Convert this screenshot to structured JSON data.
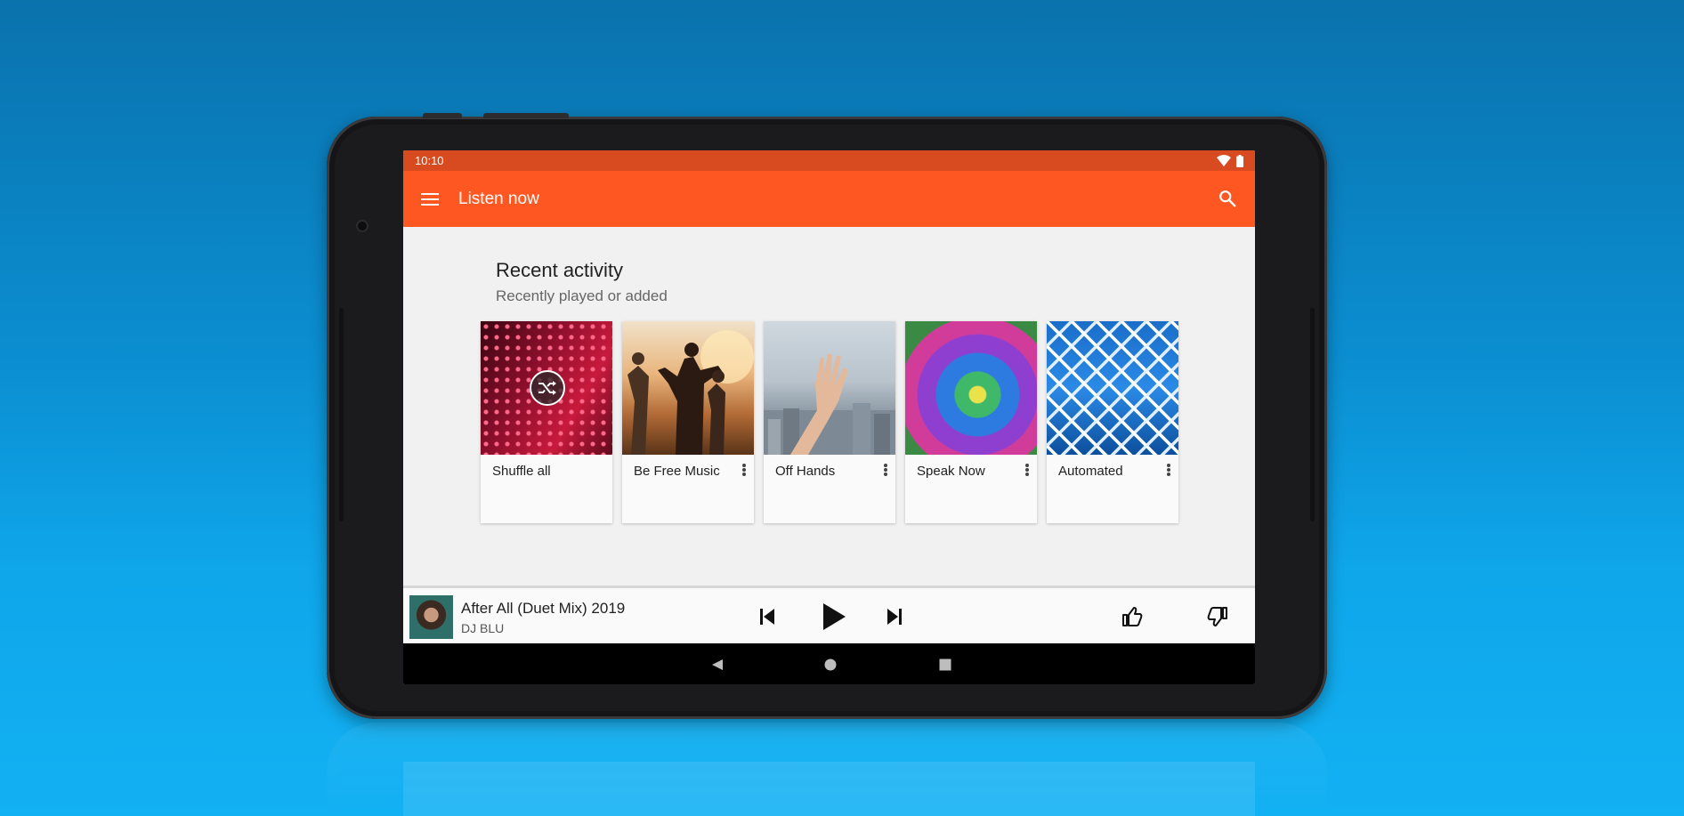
{
  "status_bar": {
    "time": "10:10"
  },
  "app_bar": {
    "title": "Listen now"
  },
  "section": {
    "title": "Recent activity",
    "subtitle": "Recently played or added"
  },
  "cards": [
    {
      "label": "Shuffle all"
    },
    {
      "label": "Be Free Music"
    },
    {
      "label": "Off Hands"
    },
    {
      "label": "Speak Now"
    },
    {
      "label": "Automated"
    }
  ],
  "now_playing": {
    "title": "After All (Duet Mix) 2019",
    "artist": "DJ BLU"
  },
  "colors": {
    "accent": "#fe5722",
    "status_bar": "#d84a1f",
    "background": "#0b8fd2"
  }
}
